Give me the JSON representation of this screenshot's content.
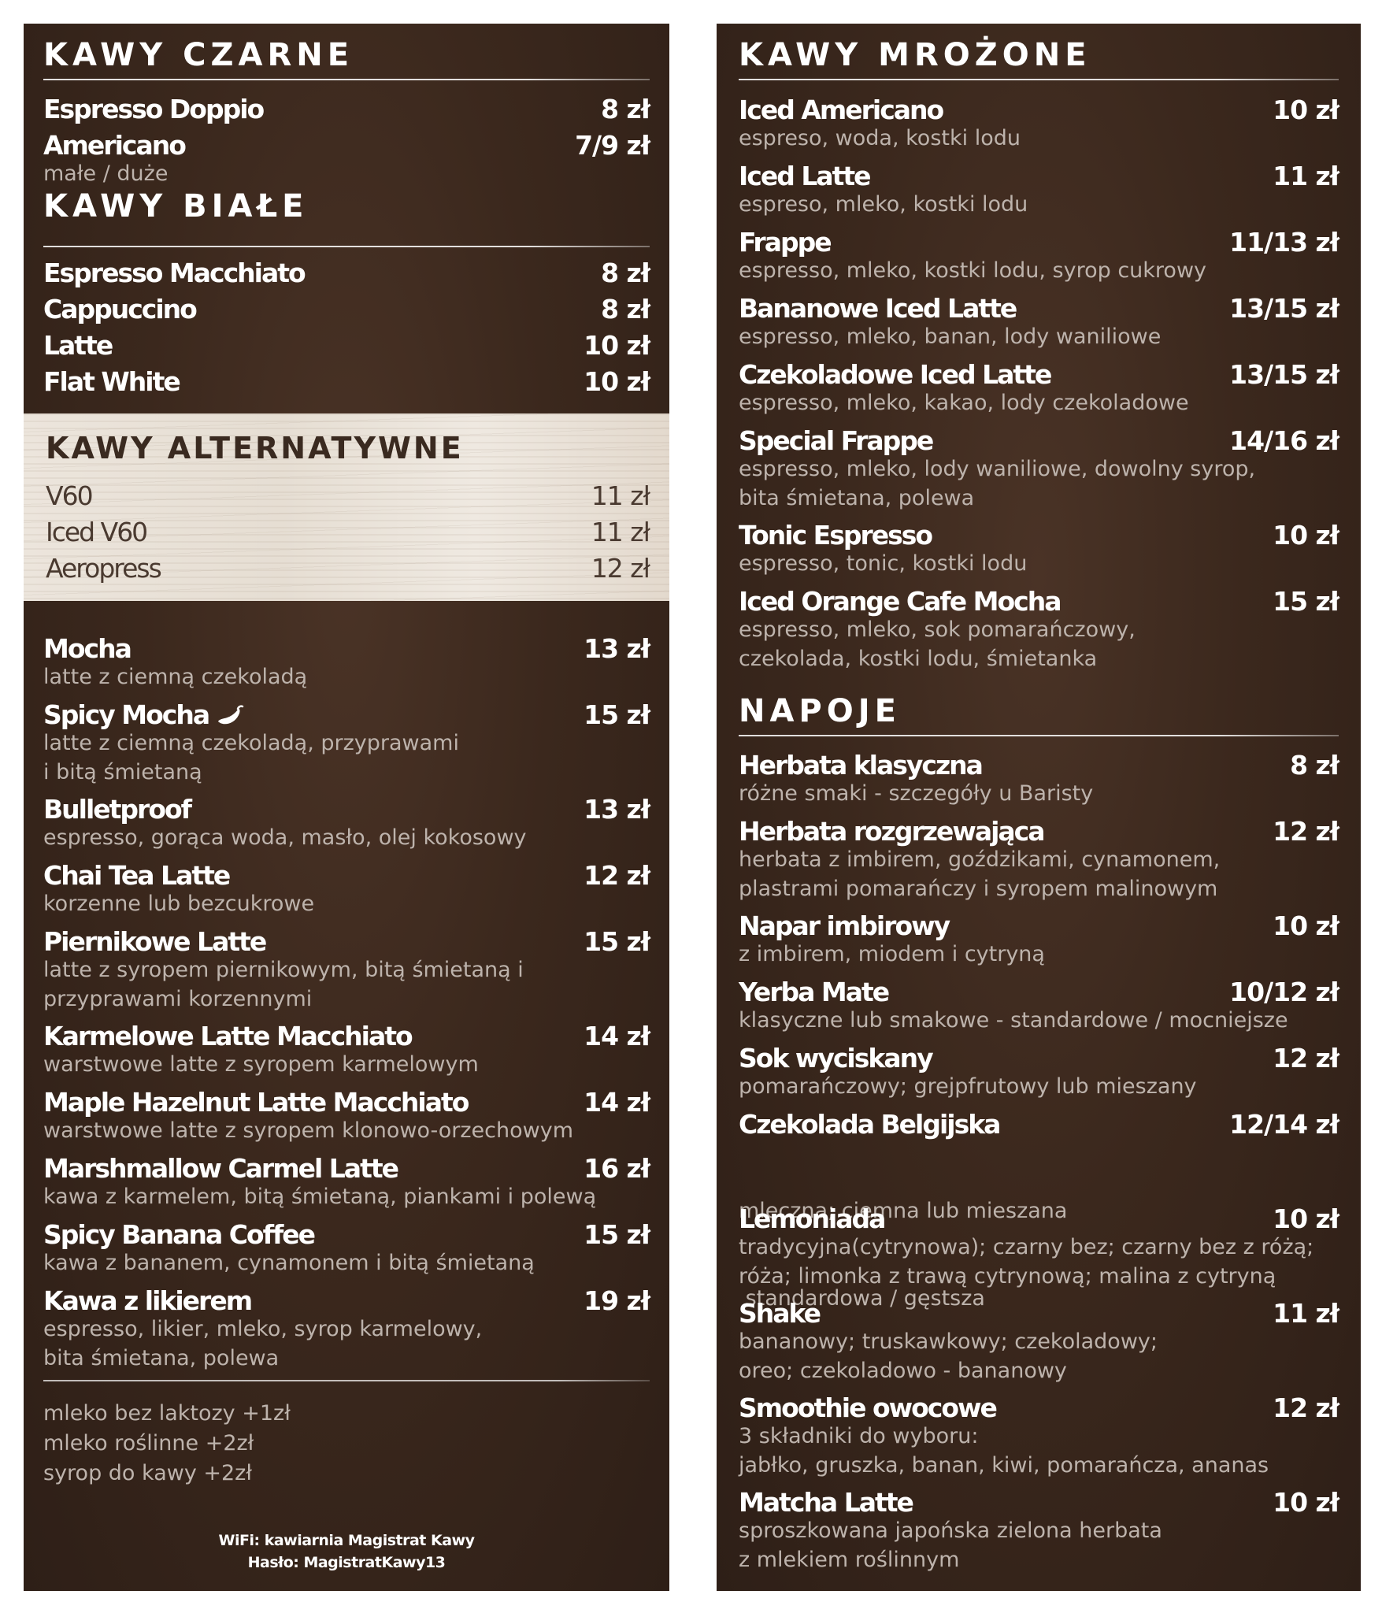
{
  "kawy_czarne": {
    "title": "KAWY CZARNE",
    "items": [
      {
        "name": "Espresso Doppio",
        "price": "8 zł"
      },
      {
        "name": "Americano",
        "price": "7/9 zł",
        "desc": [
          "małe / duże"
        ]
      }
    ]
  },
  "kawy_biale": {
    "title": "KAWY BIAŁE",
    "items": [
      {
        "name": "Espresso Macchiato",
        "price": "8 zł"
      },
      {
        "name": "Cappuccino",
        "price": "8 zł"
      },
      {
        "name": "Latte",
        "price": "10 zł"
      },
      {
        "name": "Flat White",
        "price": "10 zł"
      }
    ]
  },
  "kawy_alternatywne": {
    "title": "KAWY ALTERNATYWNE",
    "items": [
      {
        "name": "V60",
        "price": "11 zł"
      },
      {
        "name": "Iced V60",
        "price": "11 zł"
      },
      {
        "name": "Aeropress",
        "price": "12 zł"
      }
    ]
  },
  "specialty": {
    "items": [
      {
        "name": "Mocha",
        "price": "13 zł",
        "desc": [
          "latte z ciemną czekoladą"
        ]
      },
      {
        "name": "Spicy Mocha",
        "price": "15 zł",
        "desc": [
          "latte z ciemną czekoladą, przyprawami",
          "i bitą śmietaną"
        ],
        "icon": "chili-pepper-icon"
      },
      {
        "name": "Bulletproof",
        "price": "13 zł",
        "desc": [
          "espresso, gorąca woda, masło, olej kokosowy"
        ]
      },
      {
        "name": "Chai Tea Latte",
        "price": "12 zł",
        "desc": [
          "korzenne lub bezcukrowe"
        ]
      },
      {
        "name": "Piernikowe Latte",
        "price": "15 zł",
        "desc": [
          "latte z syropem piernikowym, bitą śmietaną i",
          "przyprawami korzennymi"
        ]
      },
      {
        "name": "Karmelowe Latte Macchiato",
        "price": "14 zł",
        "desc": [
          "warstwowe latte z syropem karmelowym"
        ]
      },
      {
        "name": "Maple Hazelnut Latte Macchiato",
        "price": "14 zł",
        "desc": [
          "warstwowe latte z syropem klonowo-orzechowym"
        ]
      },
      {
        "name": "Marshmallow Carmel Latte",
        "price": "16 zł",
        "desc": [
          "kawa z karmelem, bitą śmietaną, piankami i polewą"
        ]
      },
      {
        "name": "Spicy Banana Coffee",
        "price": "15 zł",
        "desc": [
          "kawa z bananem, cynamonem i bitą śmietaną"
        ]
      },
      {
        "name": "Kawa z likierem",
        "price": "19 zł",
        "desc": [
          "espresso, likier, mleko, syrop karmelowy,",
          "bita śmietana, polewa"
        ]
      }
    ]
  },
  "extras": [
    "mleko bez laktozy +1zł",
    "mleko roślinne +2zł",
    "syrop do kawy +2zł"
  ],
  "wifi": {
    "network": "WiFi: kawiarnia Magistrat Kawy",
    "password": "Hasło: MagistratKawy13"
  },
  "kawy_mrozone": {
    "title": "KAWY MROŻONE",
    "items": [
      {
        "name": "Iced Americano",
        "price": "10 zł",
        "desc": [
          "espreso, woda, kostki lodu"
        ]
      },
      {
        "name": "Iced Latte",
        "price": "11 zł",
        "desc": [
          "espreso, mleko, kostki lodu"
        ]
      },
      {
        "name": "Frappe",
        "price": "11/13 zł",
        "desc": [
          "espresso, mleko, kostki lodu, syrop cukrowy"
        ]
      },
      {
        "name": "Bananowe Iced Latte",
        "price": "13/15 zł",
        "desc": [
          "espresso, mleko, banan, lody waniliowe"
        ]
      },
      {
        "name": "Czekoladowe Iced Latte",
        "price": "13/15 zł",
        "desc": [
          "espresso, mleko, kakao, lody czekoladowe"
        ]
      },
      {
        "name": "Special Frappe",
        "price": "14/16 zł",
        "desc": [
          "espresso, mleko, lody waniliowe, dowolny syrop,",
          "bita śmietana, polewa"
        ]
      },
      {
        "name": "Tonic Espresso",
        "price": "10 zł",
        "desc": [
          "espresso, tonic, kostki lodu"
        ]
      },
      {
        "name": "Iced Orange Cafe Mocha",
        "price": "15 zł",
        "desc": [
          "espresso, mleko, sok pomarańczowy,",
          "czekolada, kostki lodu, śmietanka"
        ]
      }
    ]
  },
  "napoje": {
    "title": "NAPOJE",
    "items": [
      {
        "name": "Herbata klasyczna",
        "price": "8 zł",
        "desc": [
          "różne smaki - szczegóły u Baristy"
        ]
      },
      {
        "name": "Herbata rozgrzewająca",
        "price": "12 zł",
        "desc": [
          "herbata z imbirem, goździkami, cynamonem,",
          "plastrami pomarańczy i syropem malinowym"
        ]
      },
      {
        "name": "Napar imbirowy",
        "price": "10 zł",
        "desc": [
          "z imbirem, miodem i cytryną"
        ]
      },
      {
        "name": "Yerba Mate",
        "price": "10/12 zł",
        "desc": [
          "klasyczne lub smakowe - standardowe / mocniejsze"
        ]
      },
      {
        "name": "Sok wyciskany",
        "price": "12 zł",
        "desc": [
          "pomarańczowy; grejpfrutowy lub mieszany"
        ]
      },
      {
        "name": "Czekolada Belgijska",
        "price": "12/14 zł",
        "desc": [
          "mleczna; ciemna lub mieszana",
          " standardowa / gęstsza"
        ]
      },
      {
        "name": "Lemoniada",
        "price": "10 zł",
        "desc": [
          "tradycyjna(cytrynowa); czarny bez; czarny bez z różą;",
          "róża; limonka z trawą cytrynową; malina z cytryną"
        ]
      },
      {
        "name": "Shake",
        "price": "11 zł",
        "desc": [
          "bananowy; truskawkowy; czekoladowy;",
          "oreo; czekoladowo - bananowy"
        ]
      },
      {
        "name": "Smoothie owocowe",
        "price": "12 zł",
        "desc": [
          "3 składniki do wyboru:",
          "jabłko, gruszka, banan, kiwi, pomarańcza, ananas"
        ]
      },
      {
        "name": "Matcha Latte",
        "price": "10 zł",
        "desc": [
          "sproszkowana japońska zielona herbata",
          "z mlekiem roślinnym"
        ]
      }
    ]
  },
  "colors": {
    "panel_bg": "#3b281d",
    "text": "#ffffff",
    "desc_text": "#bdb3ac",
    "wood_band": "#e9e2d8",
    "wood_text": "#4a3a30"
  }
}
